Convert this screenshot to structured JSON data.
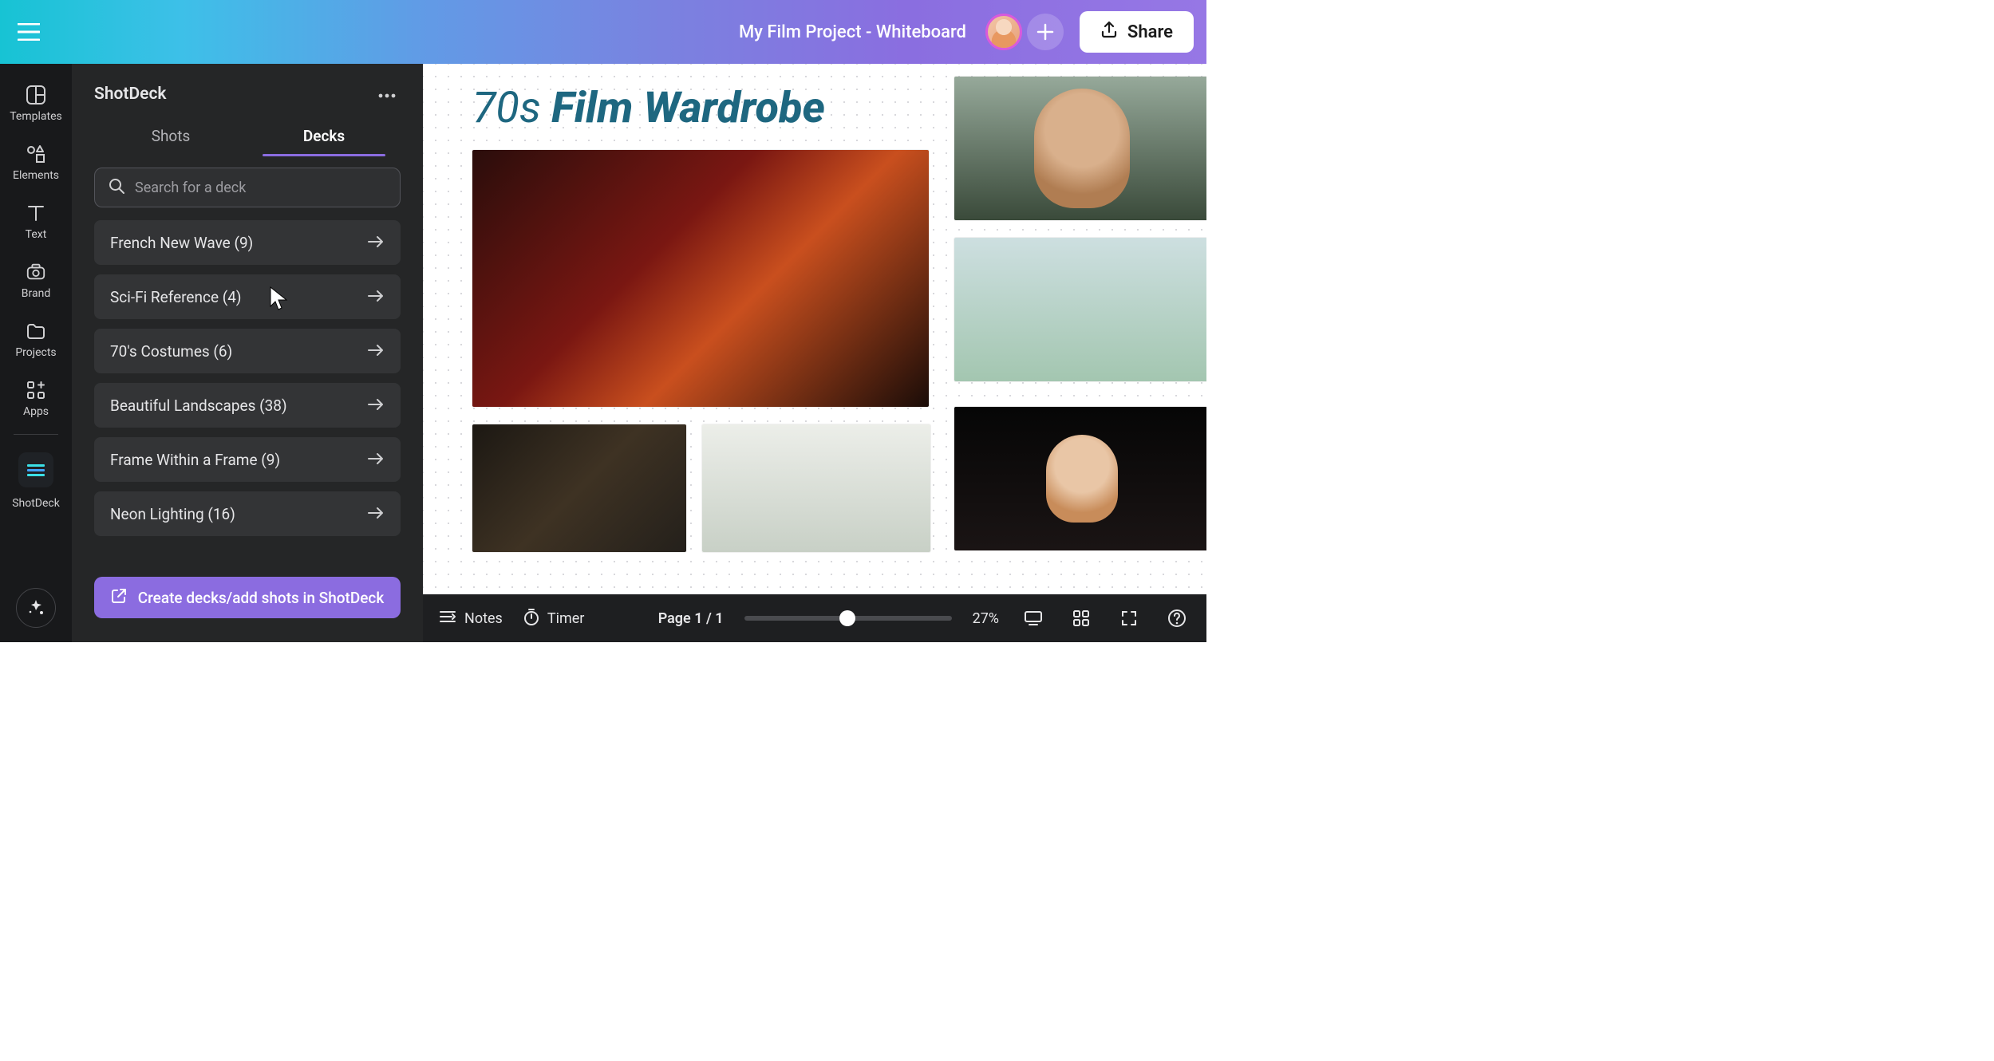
{
  "header": {
    "doc_title": "My Film Project - Whiteboard",
    "share_label": "Share"
  },
  "rail": {
    "templates": "Templates",
    "elements": "Elements",
    "text": "Text",
    "brand": "Brand",
    "projects": "Projects",
    "apps": "Apps",
    "shotdeck": "ShotDeck"
  },
  "panel": {
    "title": "ShotDeck",
    "tabs": {
      "shots": "Shots",
      "decks": "Decks",
      "active": "decks"
    },
    "search_placeholder": "Search for a deck",
    "decks": [
      {
        "label": "French New Wave (9)"
      },
      {
        "label": "Sci-Fi Reference (4)"
      },
      {
        "label": "70's Costumes (6)"
      },
      {
        "label": "Beautiful Landscapes (38)"
      },
      {
        "label": "Frame Within a Frame (9)"
      },
      {
        "label": "Neon Lighting (16)"
      }
    ],
    "create_label": "Create decks/add shots in ShotDeck"
  },
  "board": {
    "title_plain": "70s ",
    "title_bold": "Film Wardrobe"
  },
  "bottom": {
    "notes": "Notes",
    "timer": "Timer",
    "page": "Page 1 / 1",
    "zoom": "27%"
  },
  "colors": {
    "accent": "#8b6ce0",
    "teal": "#1e6780"
  }
}
